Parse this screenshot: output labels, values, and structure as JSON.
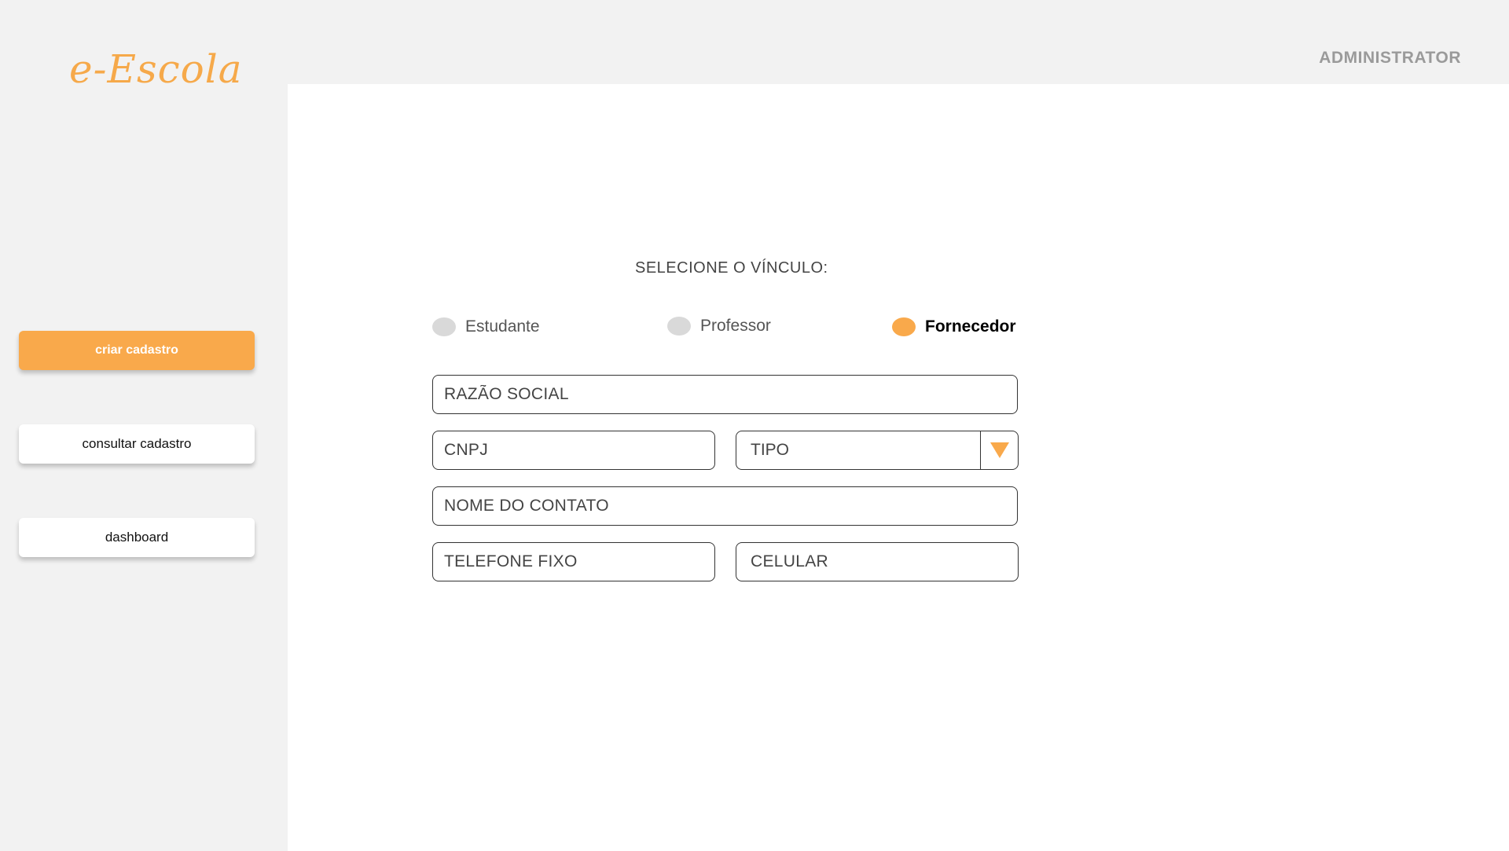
{
  "brand": {
    "logo_text": "e-Escola",
    "accent_color": "#f9a94b"
  },
  "header": {
    "user_label": "ADMINISTRATOR"
  },
  "sidebar": {
    "items": [
      {
        "label": "criar cadastro",
        "active": true
      },
      {
        "label": "consultar cadastro",
        "active": false
      },
      {
        "label": "dashboard",
        "active": false
      }
    ]
  },
  "form": {
    "title": "SELECIONE O VÍNCULO:",
    "vinculo_options": [
      {
        "label": "Estudante",
        "selected": false
      },
      {
        "label": "Professor",
        "selected": false
      },
      {
        "label": "Fornecedor",
        "selected": true
      }
    ],
    "fields": {
      "razao_social": {
        "placeholder": "RAZÃO SOCIAL",
        "value": ""
      },
      "cnpj": {
        "placeholder": "CNPJ",
        "value": ""
      },
      "tipo": {
        "selected": "TIPO"
      },
      "nome_contato": {
        "placeholder": "NOME DO CONTATO",
        "value": ""
      },
      "telefone_fixo": {
        "placeholder": "TELEFONE FIXO",
        "value": ""
      },
      "celular": {
        "placeholder": "CELULAR",
        "value": ""
      }
    }
  },
  "icons": {
    "tipo_dropdown": "triangle-down-icon"
  }
}
